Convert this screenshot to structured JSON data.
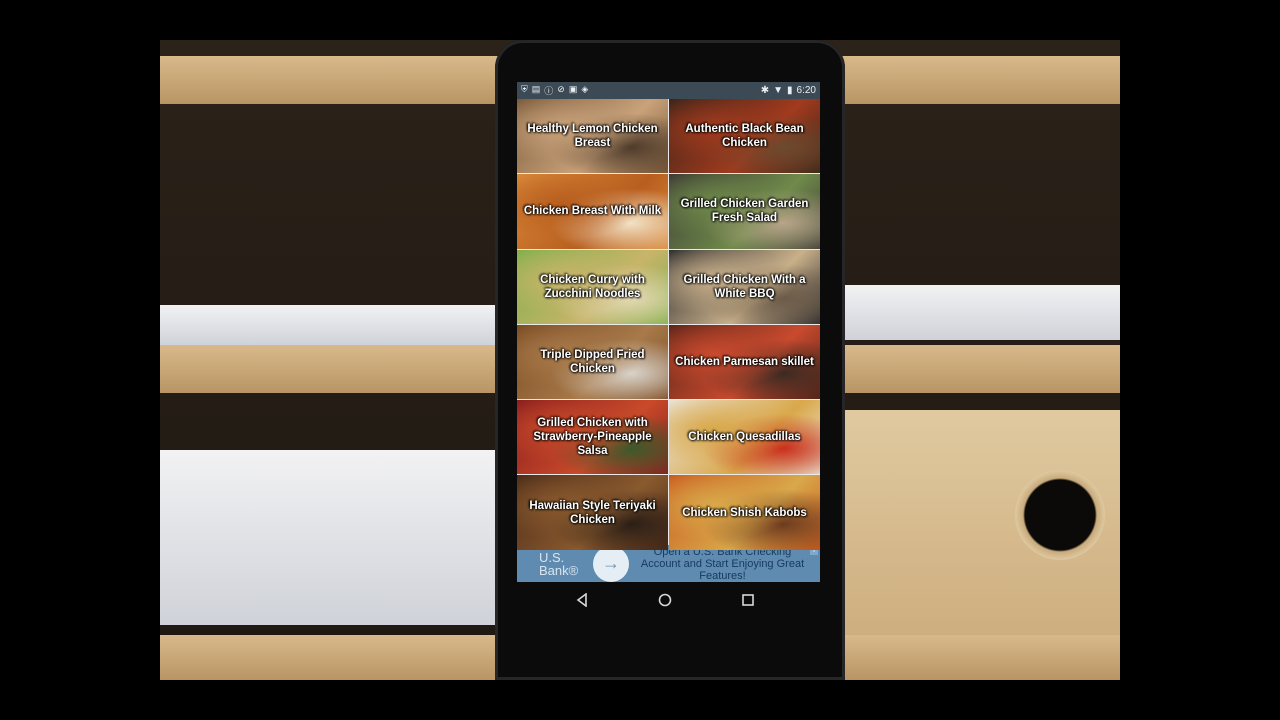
{
  "status_bar": {
    "time": "6:20",
    "left_icons": [
      "shield-icon",
      "message-icon",
      "info-icon",
      "crossed-icon",
      "lock-icon",
      "android-icon"
    ],
    "right_icons": [
      "bluetooth-icon",
      "wifi-icon",
      "battery-icon"
    ]
  },
  "recipes": [
    {
      "label": "Healthy Lemon Chicken Breast",
      "colors": [
        "#7a5a3a",
        "#c9a27a",
        "#4d3a2a"
      ]
    },
    {
      "label": "Authentic Black Bean Chicken",
      "colors": [
        "#3a2418",
        "#a23a1e",
        "#6b4a2e"
      ]
    },
    {
      "label": "Chicken Breast With Milk",
      "colors": [
        "#d98a3a",
        "#b85e1f",
        "#f3e3c8"
      ]
    },
    {
      "label": "Grilled Chicken Garden Fresh Salad",
      "colors": [
        "#3c3a34",
        "#6f8a4a",
        "#b9a58a"
      ]
    },
    {
      "label": "Chicken Curry with Zucchini Noodles",
      "colors": [
        "#7fb04a",
        "#c8b46a",
        "#e3d9b4"
      ]
    },
    {
      "label": "Grilled Chicken With a White BBQ",
      "colors": [
        "#2d2d2f",
        "#c9b08a",
        "#6b5a48"
      ]
    },
    {
      "label": "Triple Dipped Fried Chicken",
      "colors": [
        "#7a4a22",
        "#a87a4a",
        "#d9d4cc"
      ]
    },
    {
      "label": "Chicken Parmesan skillet",
      "colors": [
        "#5a2418",
        "#c94a2e",
        "#3a2a22"
      ]
    },
    {
      "label": "Grilled Chicken with Strawberry-Pineapple Salsa",
      "colors": [
        "#8a1e1e",
        "#c94a2a",
        "#3a5a2a"
      ]
    },
    {
      "label": "Chicken Quesadillas",
      "colors": [
        "#eae4d8",
        "#d9a84a",
        "#c92e1e"
      ]
    },
    {
      "label": "Hawaiian Style Teriyaki Chicken",
      "colors": [
        "#4a2a18",
        "#8a5a2e",
        "#2a1e16"
      ]
    },
    {
      "label": "Chicken Shish Kabobs",
      "colors": [
        "#c95a1e",
        "#d9a84a",
        "#6b3a1e"
      ]
    }
  ],
  "ad": {
    "brand": "U.S. Bank®",
    "arrow": "→",
    "text": "Open a U.S. Bank Checking Account and Start Enjoying Great Features!",
    "choice": "i"
  },
  "nav": {
    "back_icon": "back-triangle-icon",
    "home_icon": "home-circle-icon",
    "recents_icon": "recents-square-icon"
  }
}
